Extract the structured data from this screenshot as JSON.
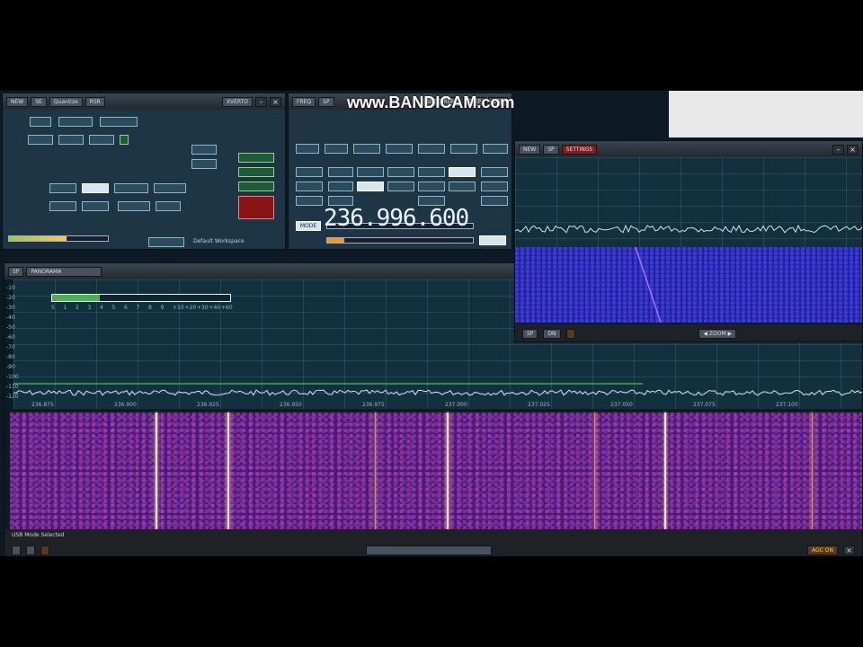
{
  "watermark": "www.BANDICAM.com",
  "frequency": "236.996.600",
  "colors": {
    "spectrum_line": "#5fe05f",
    "waterfall_main": "#4a1a7a",
    "waterfall_small": "#1f1fa0",
    "carrier": "#ffe0b0",
    "rec_button": "#8a1414"
  },
  "left_window": {
    "title_buttons": [
      "NEW",
      "SE",
      "Quantize",
      "RSR",
      "XVERTO"
    ],
    "bottom_text": "Default Workspace",
    "meter": 0.58
  },
  "right_window": {
    "title_buttons": [
      "FREQ",
      "SP",
      "SPECTRUM",
      "STEP",
      "DSP"
    ],
    "mode_label": "MODE",
    "level": 0.12
  },
  "small_window": {
    "title_buttons": [
      "NEW",
      "SP",
      "SETTINGS"
    ],
    "bottom_buttons": [
      "SP",
      "DN"
    ],
    "bottom_center": "◀ ZOOM ▶"
  },
  "main_window": {
    "title": "PANORAMA",
    "s_meter_scale": [
      "S",
      "1",
      "2",
      "3",
      "4",
      "5",
      "6",
      "7",
      "8",
      "9",
      "+10",
      "+20",
      "+30",
      "+40",
      "+60"
    ],
    "s_meter": 0.27,
    "db_labels": [
      "-10",
      "-20",
      "-30",
      "-40",
      "-50",
      "-60",
      "-70",
      "-80",
      "-90",
      "-100",
      "-110",
      "-120"
    ],
    "freq_ticks": [
      "236.875",
      "236.900",
      "236.925",
      "236.950",
      "236.975",
      "237.000",
      "237.025",
      "237.050",
      "237.075",
      "237.100"
    ],
    "status_left": "USB Mode Selected",
    "status_right": "AGC ON"
  }
}
